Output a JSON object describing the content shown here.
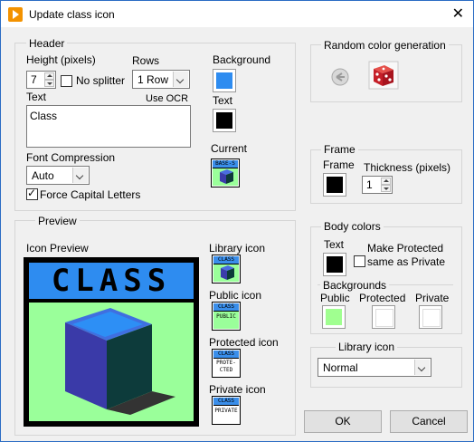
{
  "window": {
    "title": "Update class icon"
  },
  "header": {
    "group_label": "Header",
    "height_label": "Height (pixels)",
    "height_value": "7",
    "no_splitter_label": "No splitter",
    "rows_label": "Rows",
    "rows_value": "1 Row",
    "text_label": "Text",
    "use_ocr_label": "Use OCR",
    "text_value": "Class",
    "font_compression_label": "Font Compression",
    "font_compression_value": "Auto",
    "force_caps_label": "Force Capital Letters",
    "force_caps_checked": true,
    "background_label": "Background",
    "background_color": "#2e8cf0",
    "text_color_label": "Text",
    "text_color": "#000000",
    "current_label": "Current",
    "current_icon_text": "BASE-S"
  },
  "random": {
    "group_label": "Random color generation"
  },
  "frame": {
    "group_label": "Frame",
    "frame_label": "Frame",
    "frame_color": "#000000",
    "thickness_label": "Thickness (pixels)",
    "thickness_value": "1"
  },
  "body_colors": {
    "group_label": "Body colors",
    "text_label": "Text",
    "text_color": "#000000",
    "make_protected_line1": "Make Protected",
    "make_protected_line2": "same as Private",
    "backgrounds_label": "Backgrounds",
    "public_label": "Public",
    "public_color": "#a0ff90",
    "protected_label": "Protected",
    "protected_color": "#ffffff",
    "private_label": "Private",
    "private_color": "#ffffff"
  },
  "library": {
    "group_label": "Library icon",
    "value": "Normal"
  },
  "preview": {
    "group_label": "Preview",
    "icon_preview_label": "Icon Preview",
    "banner_text": "CLASS",
    "header_color": "#2e8cf0",
    "body_color": "#9aff9a",
    "library_icon_label": "Library icon",
    "public_icon_label": "Public icon",
    "protected_icon_label": "Protected icon",
    "private_icon_label": "Private icon",
    "mini_header_text": "CLASS",
    "public_text": "PUBLIC",
    "protected_text_1": "PROTE-",
    "protected_text_2": "CTED",
    "private_text": "PRIVATE"
  },
  "buttons": {
    "ok": "OK",
    "cancel": "Cancel"
  }
}
